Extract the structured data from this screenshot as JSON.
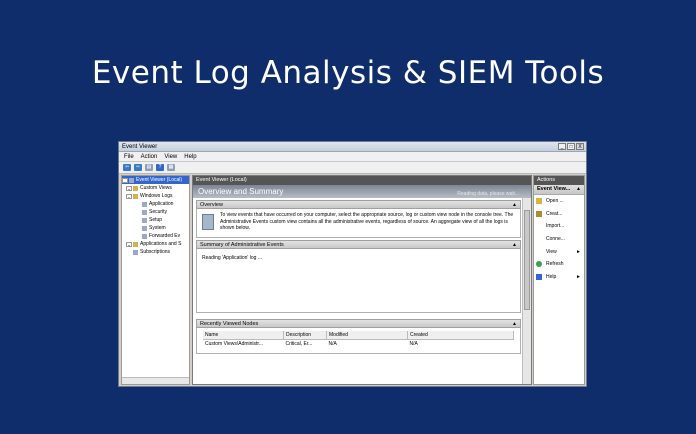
{
  "headline": "Event Log Analysis & SIEM Tools",
  "window": {
    "title": "Event Viewer",
    "buttons": {
      "minimize": "_",
      "maximize": "□",
      "close": "X"
    }
  },
  "menu": {
    "file": "File",
    "action": "Action",
    "view": "View",
    "help": "Help"
  },
  "toolbar": {
    "back": "⇦",
    "forward": "⇨",
    "show_hide": "▤",
    "help": "?",
    "properties": "▦"
  },
  "tree": {
    "root": "Event Viewer (Local)",
    "custom_views": "Custom Views",
    "windows_logs": "Windows Logs",
    "application": "Application",
    "security": "Security",
    "setup": "Setup",
    "system": "System",
    "forwarded": "Forwarded Ev",
    "apps_services": "Applications and S",
    "subscriptions": "Subscriptions",
    "expand_minus": "−",
    "expand_plus": "+"
  },
  "center": {
    "header": "Event Viewer (Local)",
    "overview_title": "Overview and Summary",
    "reading_status": "Reading data, please wait...",
    "overview": {
      "heading": "Overview",
      "text": "To view events that have occurred on your computer, select the appropriate source, log or custom view node in the console tree. The Administrative Events custom view contains all the administrative events, regardless of source. An aggregate view of all the logs is shown below."
    },
    "summary": {
      "heading": "Summary of Administrative Events",
      "text": "Reading 'Application' log ..."
    },
    "recent": {
      "heading": "Recently Viewed Nodes",
      "columns": [
        "Name",
        "Description",
        "Modified",
        "Created"
      ],
      "rows": [
        [
          "Custom Views\\Administr...",
          "Critical, Er...",
          "N/A",
          "N/A"
        ]
      ]
    },
    "section_arrow": "▲"
  },
  "actions": {
    "header": "Actions",
    "subheader": "Event View...",
    "subheader_arrow": "▲",
    "submenu_arrow": "►",
    "items": [
      {
        "label": "Open ...",
        "color": "#e0b040"
      },
      {
        "label": "Creat...",
        "color": "#b08a30"
      },
      {
        "label": "Import...",
        "color": "#c0c0c0"
      },
      {
        "label": "Conne...",
        "color": "#c0c0c0"
      },
      {
        "label": "View",
        "color": "#c0c0c0",
        "submenu": true
      },
      {
        "label": "Refresh",
        "color": "#3aa050"
      },
      {
        "label": "Help",
        "color": "#3366cc",
        "submenu": true
      }
    ]
  },
  "colors": {
    "background": "#0f2d6b",
    "selection": "#3366cc"
  }
}
